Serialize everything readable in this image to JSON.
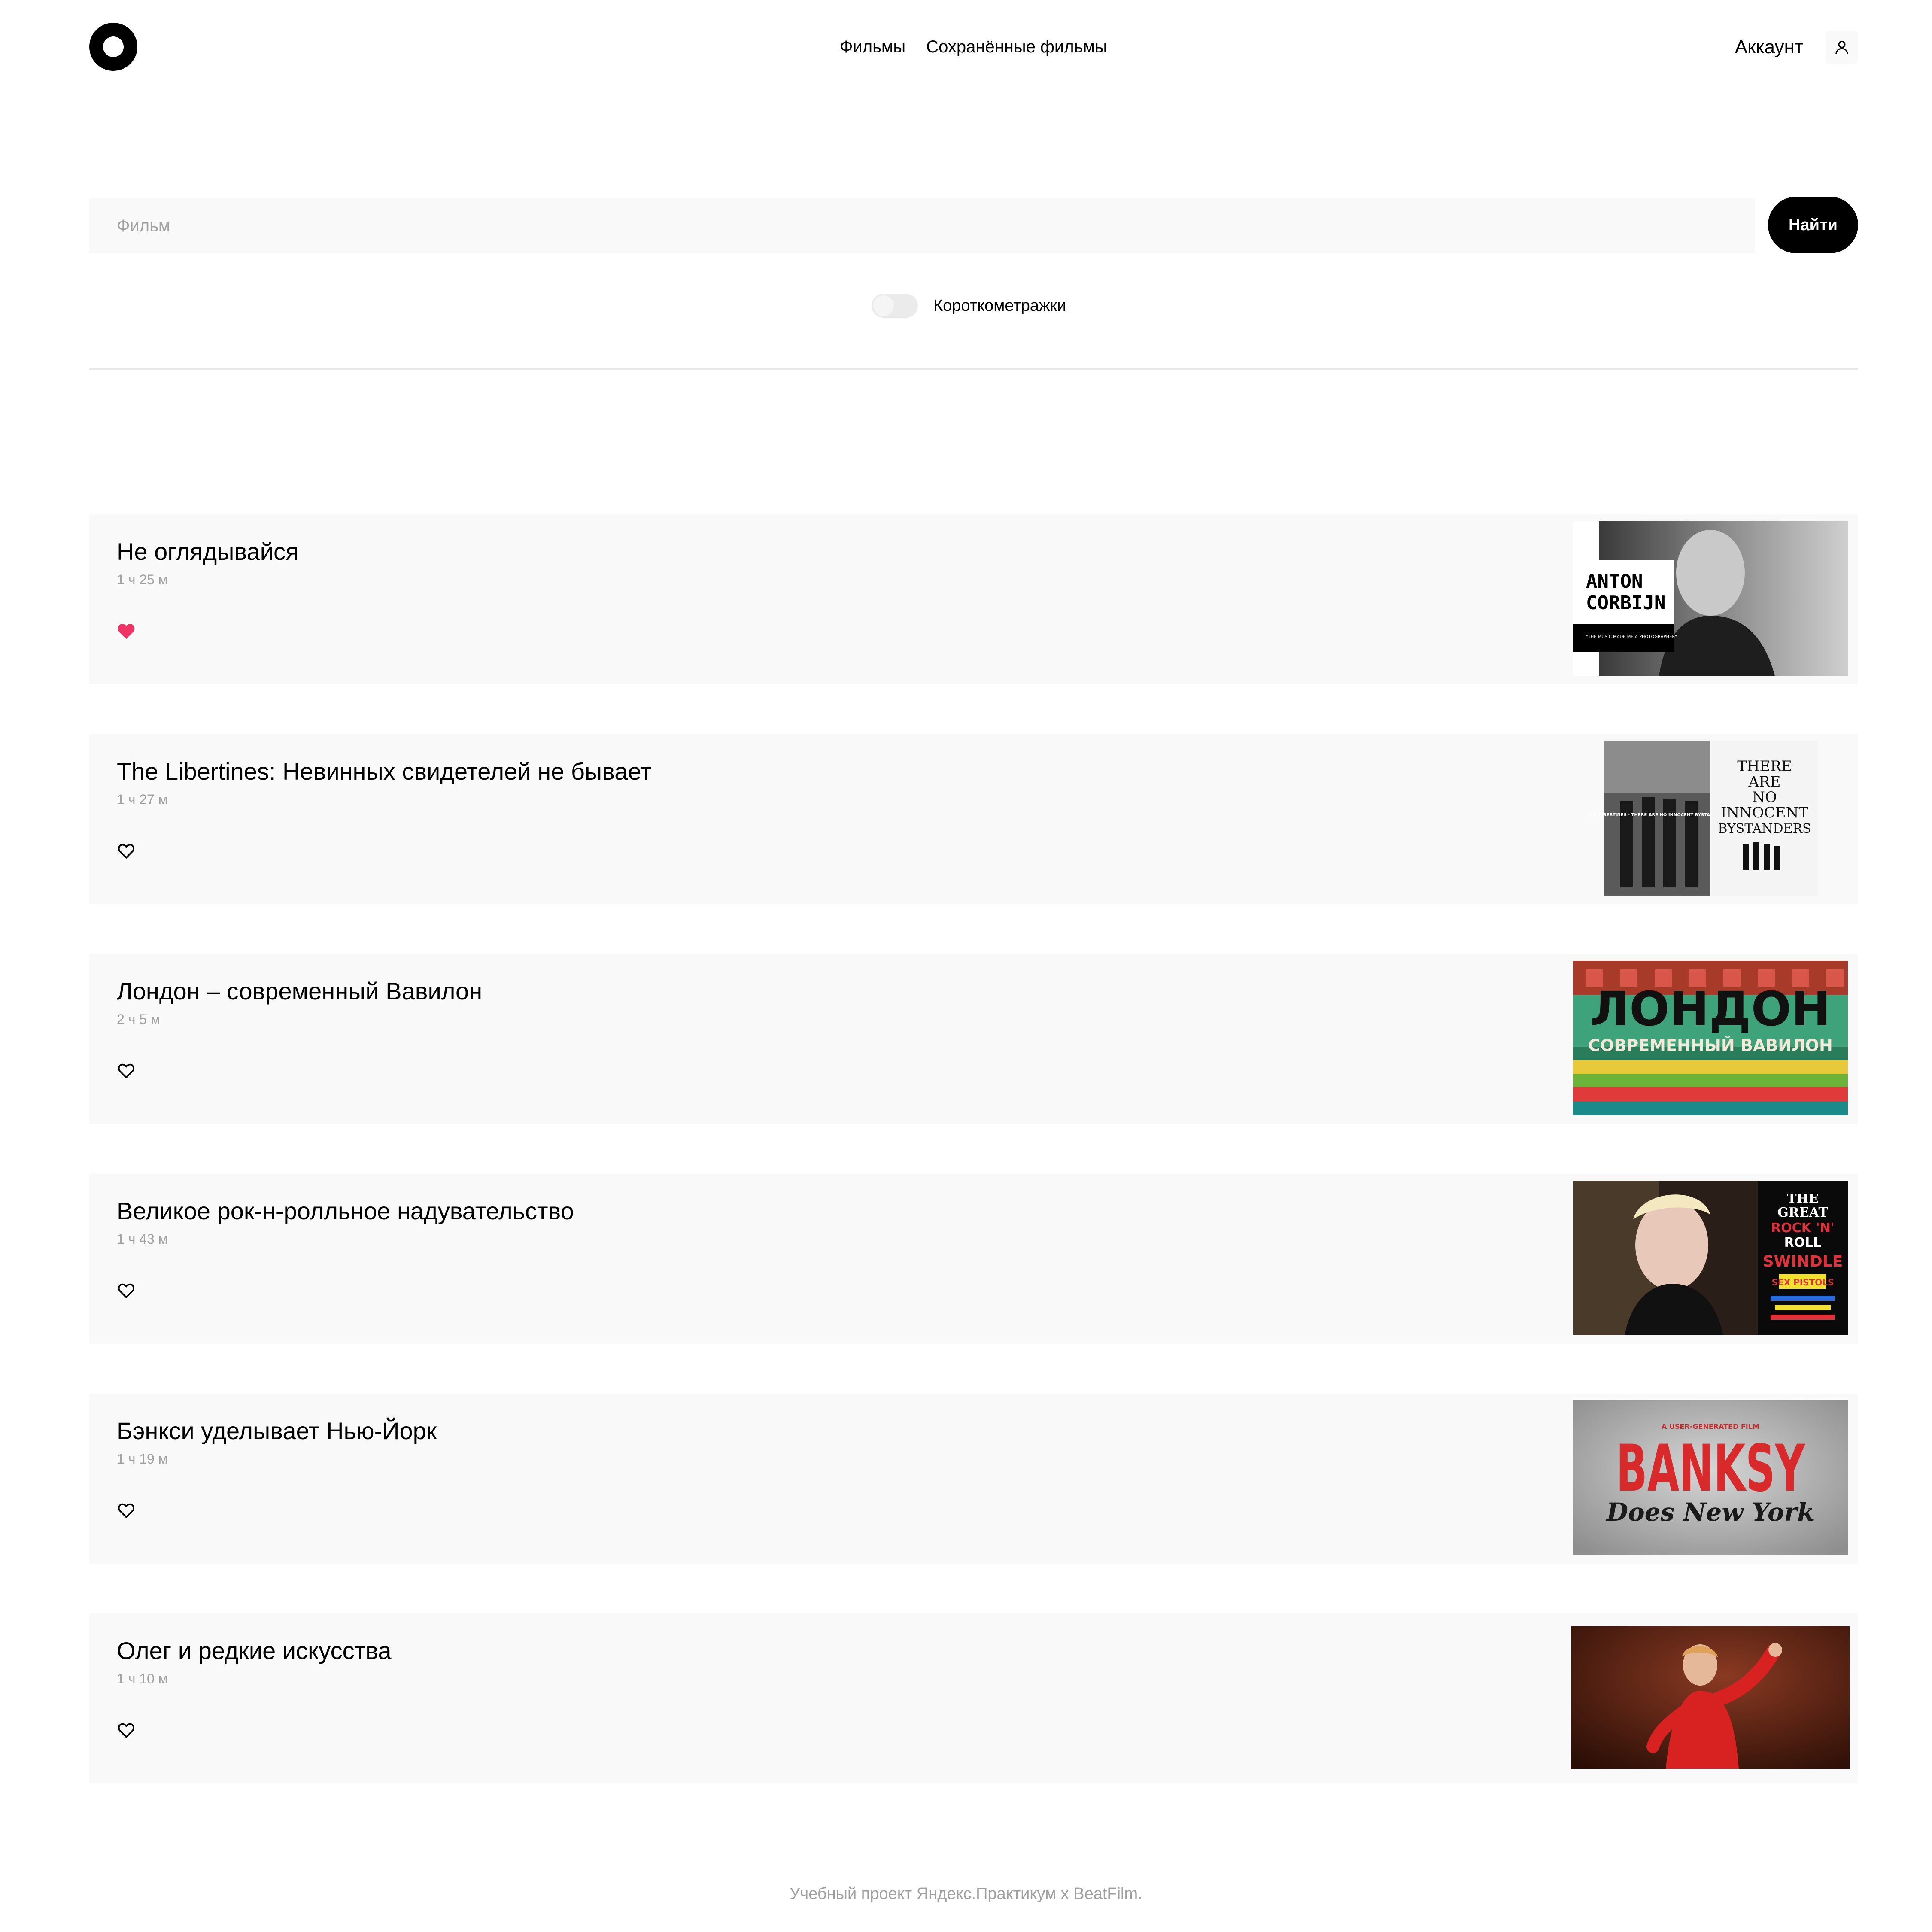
{
  "header": {
    "logo": "logo-ring",
    "nav": [
      {
        "label": "Фильмы"
      },
      {
        "label": "Сохранённые фильмы"
      }
    ],
    "account_label": "Аккаунт",
    "account_icon": "user-icon"
  },
  "search": {
    "placeholder": "Фильм",
    "value": "",
    "button_label": "Найти"
  },
  "filter": {
    "short_films_label": "Короткометражки",
    "short_films_on": false
  },
  "movies": [
    {
      "title": "Не оглядывайся",
      "duration": "1 ч 25 м",
      "saved": true,
      "poster_text": [
        "ANTON",
        "CORBIJN",
        "\"THE MUSIC MADE ME A PHOTOGRAPHER\""
      ]
    },
    {
      "title": "The Libertines: Невинных свидетелей не бывает",
      "duration": "1 ч 27 м",
      "saved": false,
      "poster_text": [
        "THE LIBERTINES · THERE ARE NO INNOCENT BYSTANDERS",
        "THERE",
        "ARE",
        "NO",
        "INNOCENT",
        "BYSTANDERS"
      ]
    },
    {
      "title": "Лондон – современный Вавилон",
      "duration": "2 ч 5 м",
      "saved": false,
      "poster_text": [
        "ЛОНДОН",
        "СОВРЕМЕННЫЙ ВАВИЛОН"
      ]
    },
    {
      "title": "Великое рок-н-ролльное надувательство",
      "duration": "1 ч 43 м",
      "saved": false,
      "poster_text": [
        "THE",
        "GREAT",
        "ROCK 'N'",
        "ROLL",
        "SWINDLE",
        "SEX PISTOLS"
      ]
    },
    {
      "title": "Бэнкси уделывает Нью-Йорк",
      "duration": "1 ч 19 м",
      "saved": false,
      "poster_text": [
        "A USER-GENERATED FILM",
        "BANKSY",
        "Does New York"
      ]
    },
    {
      "title": "Олег и редкие искусства",
      "duration": "1 ч 10 м",
      "saved": false,
      "poster_text": []
    }
  ],
  "colors": {
    "accent_heart": "#ee3465",
    "card_bg": "#f9f9f9",
    "muted_text": "#a0a0a0"
  },
  "footer": {
    "text": "Учебный проект Яндекс.Практикум х BeatFilm."
  }
}
